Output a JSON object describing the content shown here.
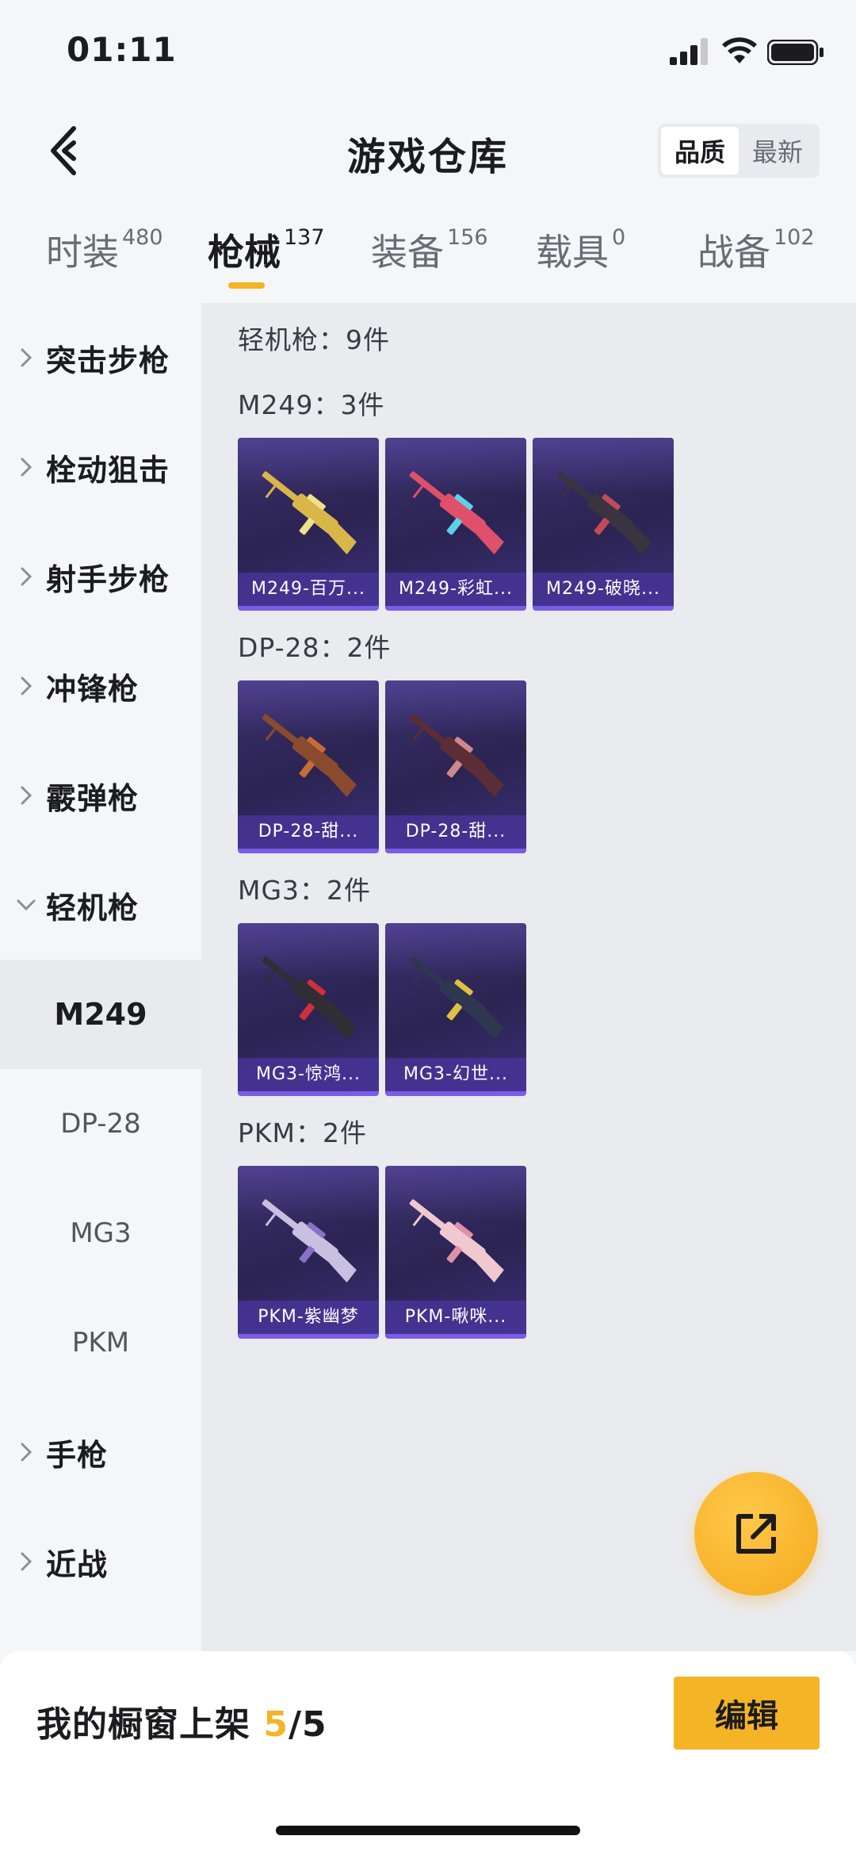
{
  "status_bar": {
    "time": "01:11"
  },
  "header": {
    "title": "游戏仓库",
    "sort_options": [
      {
        "label": "品质",
        "active": true
      },
      {
        "label": "最新",
        "active": false
      }
    ]
  },
  "tabs": [
    {
      "label": "时装",
      "count": "480",
      "active": false
    },
    {
      "label": "枪械",
      "count": "137",
      "active": true
    },
    {
      "label": "装备",
      "count": "156",
      "active": false
    },
    {
      "label": "载具",
      "count": "0",
      "active": false
    },
    {
      "label": "战备",
      "count": "102",
      "active": false
    }
  ],
  "sidebar": {
    "categories": [
      {
        "label": "突击步枪",
        "expanded": false
      },
      {
        "label": "栓动狙击",
        "expanded": false
      },
      {
        "label": "射手步枪",
        "expanded": false
      },
      {
        "label": "冲锋枪",
        "expanded": false
      },
      {
        "label": "霰弹枪",
        "expanded": false
      },
      {
        "label": "轻机枪",
        "expanded": true
      }
    ],
    "subitems": [
      {
        "label": "M249",
        "active": true
      },
      {
        "label": "DP-28",
        "active": false
      },
      {
        "label": "MG3",
        "active": false
      },
      {
        "label": "PKM",
        "active": false
      }
    ],
    "more_categories": [
      {
        "label": "手枪",
        "expanded": false
      },
      {
        "label": "近战",
        "expanded": false
      }
    ]
  },
  "content": {
    "category_summary": "轻机枪：9件",
    "groups": [
      {
        "title": "M249：3件",
        "items": [
          {
            "name": "M249-百万...",
            "gun_color": "#d9b64a",
            "accent": "#f0e08a"
          },
          {
            "name": "M249-彩虹...",
            "gun_color": "#e0506a",
            "accent": "#5fd0e8"
          },
          {
            "name": "M249-破晓...",
            "gun_color": "#3a3340",
            "accent": "#c04a5a"
          }
        ]
      },
      {
        "title": "DP-28：2件",
        "items": [
          {
            "name": "DP-28-甜...",
            "gun_color": "#8a4a2e",
            "accent": "#c86a3a"
          },
          {
            "name": "DP-28-甜...",
            "gun_color": "#5a2e34",
            "accent": "#d08890"
          }
        ]
      },
      {
        "title": "MG3：2件",
        "items": [
          {
            "name": "MG3-惊鸿...",
            "gun_color": "#2e2e34",
            "accent": "#d0303a"
          },
          {
            "name": "MG3-幻世...",
            "gun_color": "#2e3650",
            "accent": "#e0c040"
          }
        ]
      },
      {
        "title": "PKM：2件",
        "items": [
          {
            "name": "PKM-紫幽梦",
            "gun_color": "#c8c0e0",
            "accent": "#8a70c8"
          },
          {
            "name": "PKM-啾咪...",
            "gun_color": "#f0c8d0",
            "accent": "#e090a8"
          }
        ]
      }
    ]
  },
  "bottom_bar": {
    "shelf_prefix": "我的橱窗上架 ",
    "shelf_current": "5",
    "shelf_total": "/5",
    "edit_label": "编辑"
  },
  "colors": {
    "accent": "#f5b326",
    "card_border": "#7a5ce6"
  }
}
